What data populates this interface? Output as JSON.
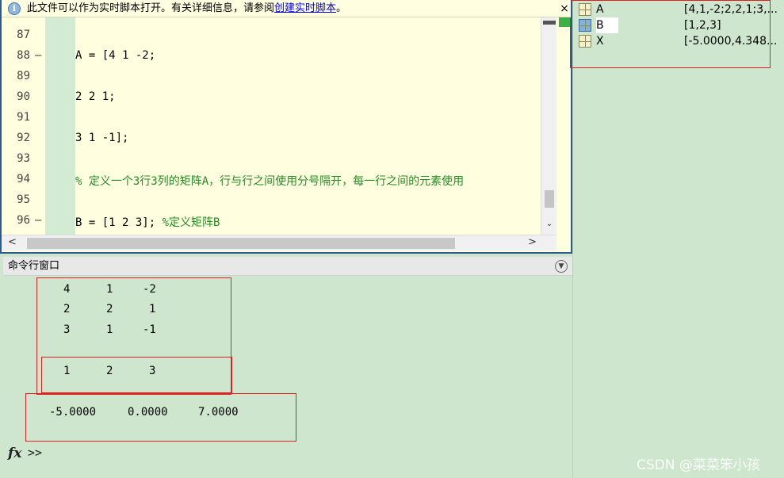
{
  "info_bar": {
    "text": "此文件可以作为实时脚本打开。有关详细信息，请参阅",
    "link": "创建实时脚本",
    "suffix": "。",
    "close": "×"
  },
  "editor": {
    "lines": [
      {
        "num": "87",
        "dash": "",
        "code": "",
        "comment": false
      },
      {
        "num": "88",
        "dash": "—",
        "code": "A = [4 1 -2;",
        "comment": false
      },
      {
        "num": "89",
        "dash": "",
        "code": "",
        "comment": false
      },
      {
        "num": "90",
        "dash": "",
        "code": "2 2 1;",
        "comment": false
      },
      {
        "num": "91",
        "dash": "",
        "code": "",
        "comment": false
      },
      {
        "num": "92",
        "dash": "",
        "code": "3 1 -1];",
        "comment": false
      },
      {
        "num": "93",
        "dash": "",
        "code": "",
        "comment": false
      },
      {
        "num": "94",
        "dash": "",
        "code": "% 定义一个3行3列的矩阵A，行与行之间使用分号隔开，每一行之间的元素使用",
        "comment": true
      },
      {
        "num": "95",
        "dash": "",
        "code": "",
        "comment": false
      },
      {
        "num": "96",
        "dash": "—",
        "code": "B = [1 2 3];",
        "comment": false,
        "trailing_comment": " %定义矩阵B"
      }
    ]
  },
  "command_window": {
    "title": "命令行窗口",
    "matrix_a": [
      [
        "4",
        "1",
        "-2"
      ],
      [
        "2",
        "2",
        "1"
      ],
      [
        "3",
        "1",
        "-1"
      ]
    ],
    "matrix_b": [
      [
        "1",
        "2",
        "3"
      ]
    ],
    "result_x": [
      "-5.0000",
      "0.0000",
      "7.0000"
    ],
    "fx": "fx",
    "prompt": ">>"
  },
  "workspace": {
    "variables": [
      {
        "name": "A",
        "value": "[4,1,-2;2,2,1;3,..."
      },
      {
        "name": "B",
        "value": "[1,2,3]"
      },
      {
        "name": "X",
        "value": "[-5.0000,4.348..."
      }
    ]
  },
  "watermark": "CSDN @菜菜笨小孩"
}
